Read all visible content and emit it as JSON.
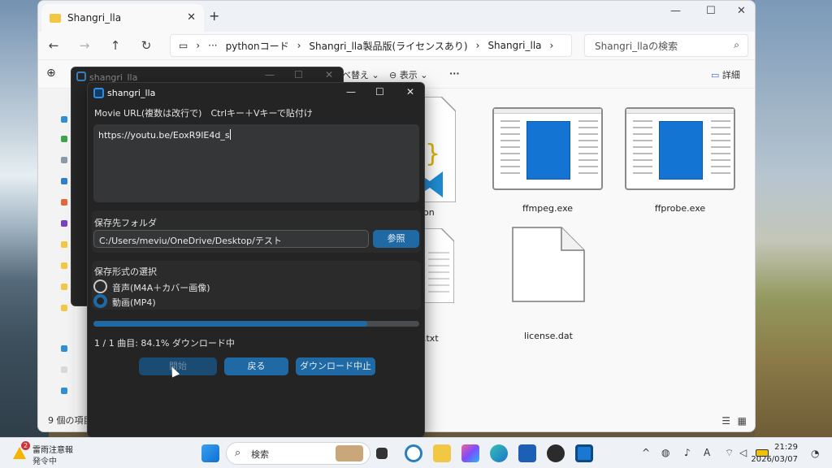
{
  "explorer": {
    "tab_title": "Shangri_lla",
    "breadcrumb": [
      "pythonコード",
      "Shangri_lla製品版(ライセンスあり)",
      "Shangri_lla"
    ],
    "ellipsis": "···",
    "search_placeholder": "Shangri_llaの検索",
    "toolbar": {
      "sort": "べ替え",
      "view": "表示",
      "more": "···",
      "details": "詳細"
    },
    "status": "9 個の項目",
    "files": [
      {
        "name": "on"
      },
      {
        "name": "ffmpeg.exe"
      },
      {
        "name": "ffprobe.exe"
      },
      {
        "name": ".txt"
      },
      {
        "name": "license.dat"
      }
    ]
  },
  "back_window": {
    "title": "shangri_lla"
  },
  "app": {
    "title": "shangri_lla",
    "url_label": "Movie URL(複数は改行で)　Ctrlキー＋Vキーで貼付け",
    "url_value": "https://youtu.be/EoxR9lE4d_s",
    "folder_label": "保存先フォルダ",
    "folder_value": "C:/Users/meviu/OneDrive/Desktop/テスト",
    "browse_button": "参照",
    "format_label": "保存形式の選択",
    "format_options": [
      "音声(M4A＋カバー画像)",
      "動画(MP4)"
    ],
    "selected_format": "動画(MP4)",
    "progress_fraction": 0.841,
    "status": "1 / 1 曲目: 84.1% ダウンロード中",
    "buttons": {
      "start": "開始",
      "back": "戻る",
      "stop": "ダウンロード中止"
    },
    "accent": "#1f6aa5"
  },
  "taskbar": {
    "weather_badge": "2",
    "weather_line1": "雷雨注意報",
    "weather_line2": "発令中",
    "search_placeholder": "検索",
    "time": "21:29",
    "date": "2026/03/07",
    "ime": "A"
  }
}
